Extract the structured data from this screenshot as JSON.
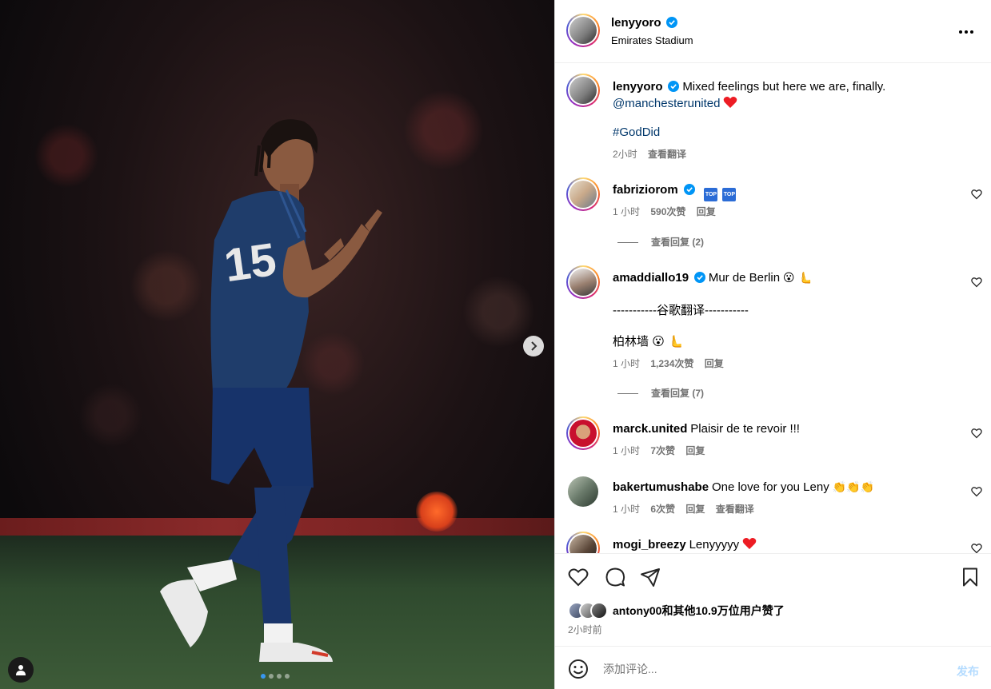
{
  "post": {
    "author": "lenyyoro",
    "location": "Emirates Stadium",
    "caption": "Mixed feelings but here we are, finally.",
    "mention": "@manchesterunited",
    "hashtag": "#GodDid",
    "caption_time": "2小时",
    "translate_label": "查看翻译",
    "photo": {
      "jersey_number": "15",
      "slides_total": 4,
      "active_slide": 1
    }
  },
  "comments": [
    {
      "username": "fabriziorom",
      "verified": true,
      "text": "",
      "badges": [
        "TOP",
        "TOP"
      ],
      "time": "1 小时",
      "likes": "590次赞",
      "reply_label": "回复",
      "view_replies": "查看回复 (2)"
    },
    {
      "username": "amaddiallo19",
      "verified": true,
      "text": "Mur de Berlin",
      "emoji": "😮 🫷",
      "translation_divider": "-----------谷歌翻译-----------",
      "translation": "柏林墙",
      "time": "1 小时",
      "likes": "1,234次赞",
      "reply_label": "回复",
      "view_replies": "查看回复 (7)"
    },
    {
      "username": "marck.united",
      "verified": false,
      "text": "Plaisir de te revoir !!!",
      "time": "1 小时",
      "likes": "7次赞",
      "reply_label": "回复"
    },
    {
      "username": "bakertumushabe",
      "verified": false,
      "text": "One love for you Leny",
      "emoji": "👏👏👏",
      "time": "1 小时",
      "likes": "6次赞",
      "reply_label": "回复",
      "translate_label": "查看翻译"
    },
    {
      "username": "mogi_breezy",
      "verified": false,
      "text": "Lenyyyyy",
      "emoji": "❤"
    }
  ],
  "likes_summary": "antony00和其他10.9万位用户赞了",
  "post_time": "2小时前",
  "comment_box": {
    "placeholder": "添加评论...",
    "post_label": "发布"
  },
  "colors": {
    "link": "#00376b",
    "verified": "#0095f6",
    "heart_red": "#ed1c24",
    "post_disabled": "#b3dbff",
    "jersey": "#1f3d6b"
  },
  "icons": [
    "verified-icon",
    "more-options-icon",
    "heart-icon",
    "comment-icon",
    "share-icon",
    "bookmark-icon",
    "emoji-icon",
    "next-arrow-icon",
    "user-tag-icon"
  ]
}
